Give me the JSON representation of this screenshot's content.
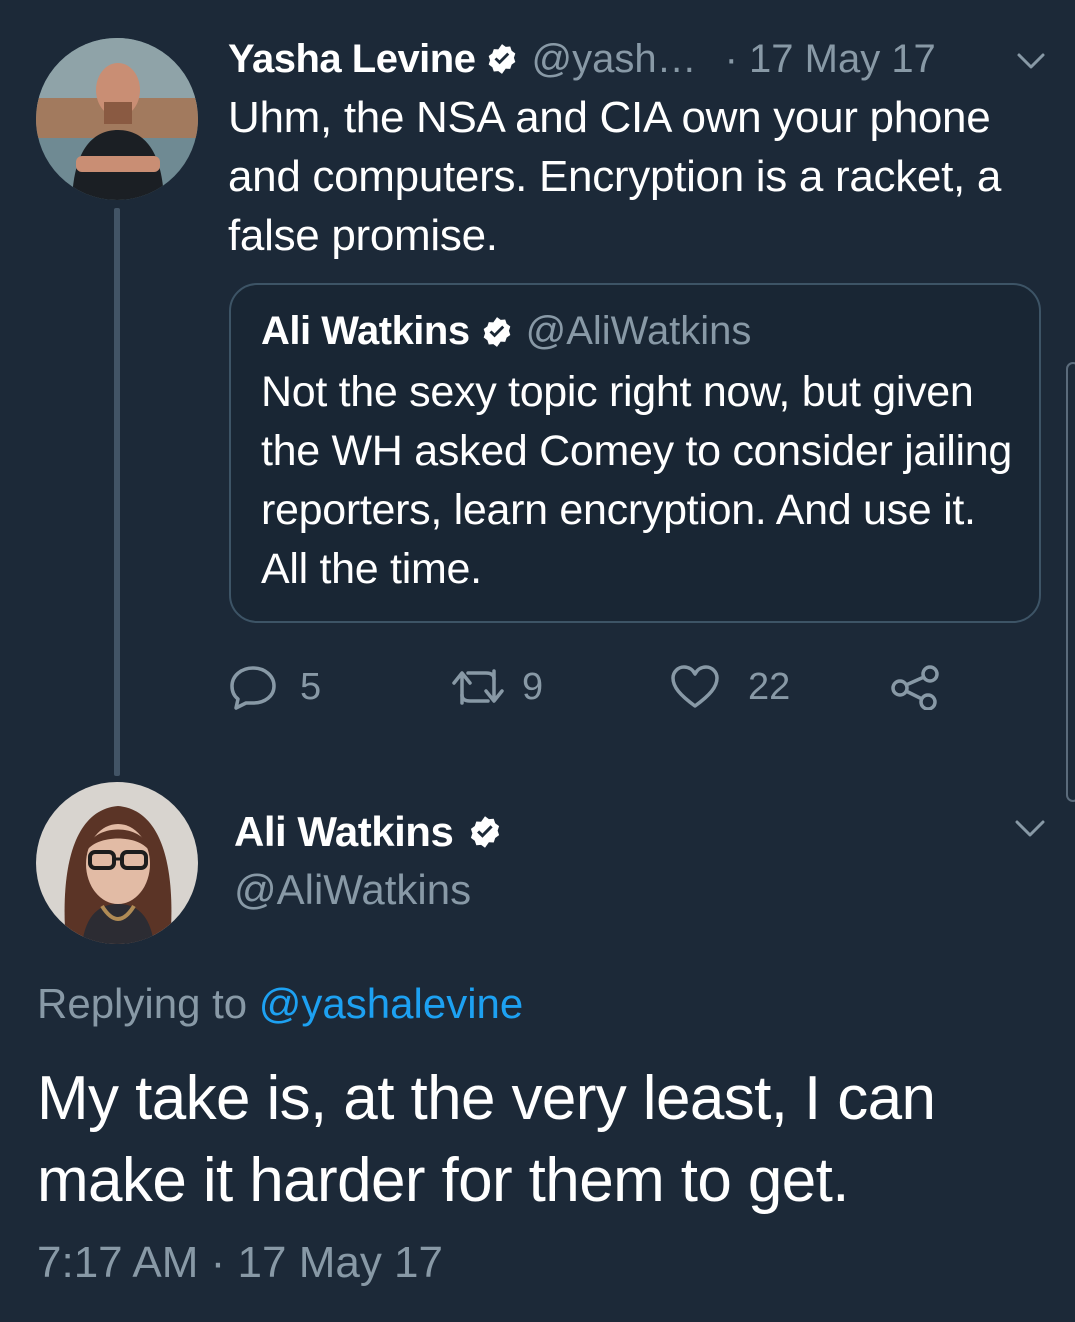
{
  "parent_tweet": {
    "author_name": "Yasha Levine",
    "handle": "@yash…",
    "date": "· 17 May 17",
    "verified": true,
    "avatar_icon": "person-avatar",
    "text": "Uhm, the NSA and CIA own your phone and computers. Encryption is a racket, a false promise.",
    "quoted_tweet": {
      "author_name": "Ali Watkins",
      "handle": "@AliWatkins",
      "verified": true,
      "text": "Not the sexy topic right now, but given the WH asked Comey to consider jailing reporters, learn encryption. And use it. All the time."
    },
    "actions": {
      "replies": "5",
      "retweets": "9",
      "likes": "22"
    }
  },
  "reply_tweet": {
    "author_name": "Ali Watkins",
    "handle": "@AliWatkins",
    "verified": true,
    "avatar_icon": "person-avatar",
    "replying_prefix": "Replying to",
    "replying_to": "@yashalevine",
    "text": "My take is, at the very least, I can make it harder for them to get.",
    "timestamp": "7:17 AM · 17 May 17"
  },
  "colors": {
    "background": "#1c2938",
    "text": "#ffffff",
    "muted": "#8899a6",
    "link": "#1da1f2",
    "border": "#3d5466"
  }
}
